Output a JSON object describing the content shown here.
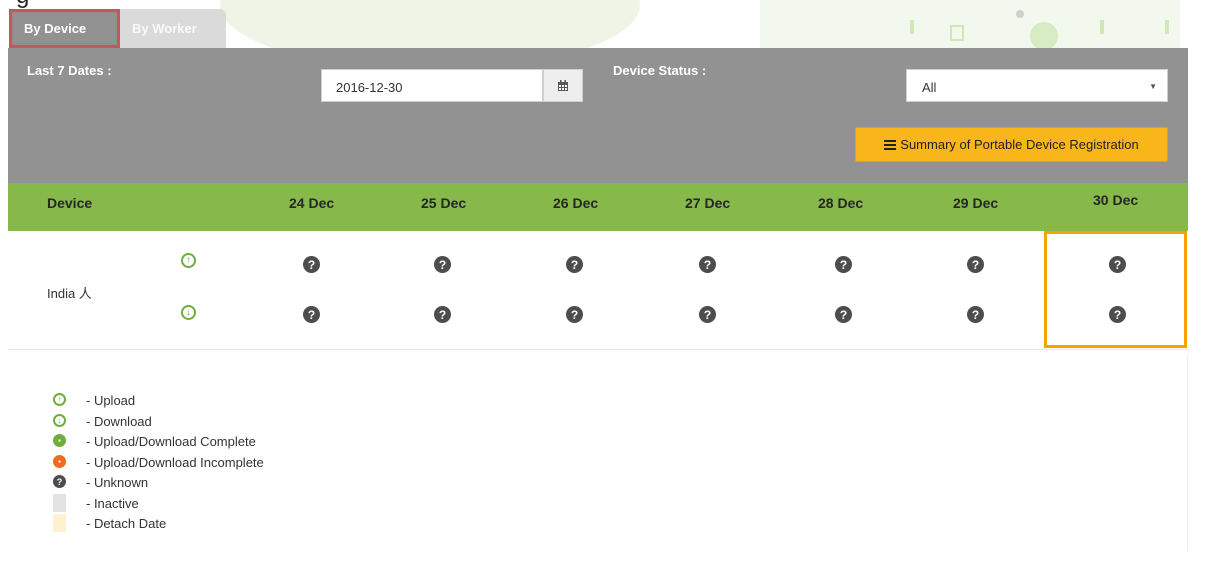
{
  "top_text": "g",
  "tabs": {
    "by_device": "By Device",
    "by_worker": "By Worker"
  },
  "filters": {
    "last7_label": "Last 7 Dates :",
    "date_value": "2016-12-30",
    "device_status_label": "Device Status :",
    "device_status_value": "All",
    "summary_button": "Summary of Portable Device Registration"
  },
  "table": {
    "device_header": "Device",
    "dates": [
      "24 Dec",
      "25 Dec",
      "26 Dec",
      "27 Dec",
      "28 Dec",
      "29 Dec",
      "30 Dec"
    ],
    "row_device": "India 人",
    "unknown_glyph": "?"
  },
  "legend": [
    {
      "icon": "upload-icon",
      "label": "- Upload"
    },
    {
      "icon": "download-icon",
      "label": "- Download"
    },
    {
      "icon": "complete-icon",
      "label": "- Upload/Download Complete"
    },
    {
      "icon": "incomplete-icon",
      "label": "- Upload/Download Incomplete"
    },
    {
      "icon": "unknown-icon",
      "label": "- Unknown"
    },
    {
      "icon": "inactive-swatch",
      "label": "- Inactive"
    },
    {
      "icon": "detach-swatch",
      "label": "- Detach Date"
    }
  ],
  "colors": {
    "panel_gray": "#929292",
    "header_green": "#86b84a",
    "summary_yellow": "#f9b61a",
    "highlight_orange": "#f4a300",
    "tab_highlight_red": "#c3575a"
  }
}
